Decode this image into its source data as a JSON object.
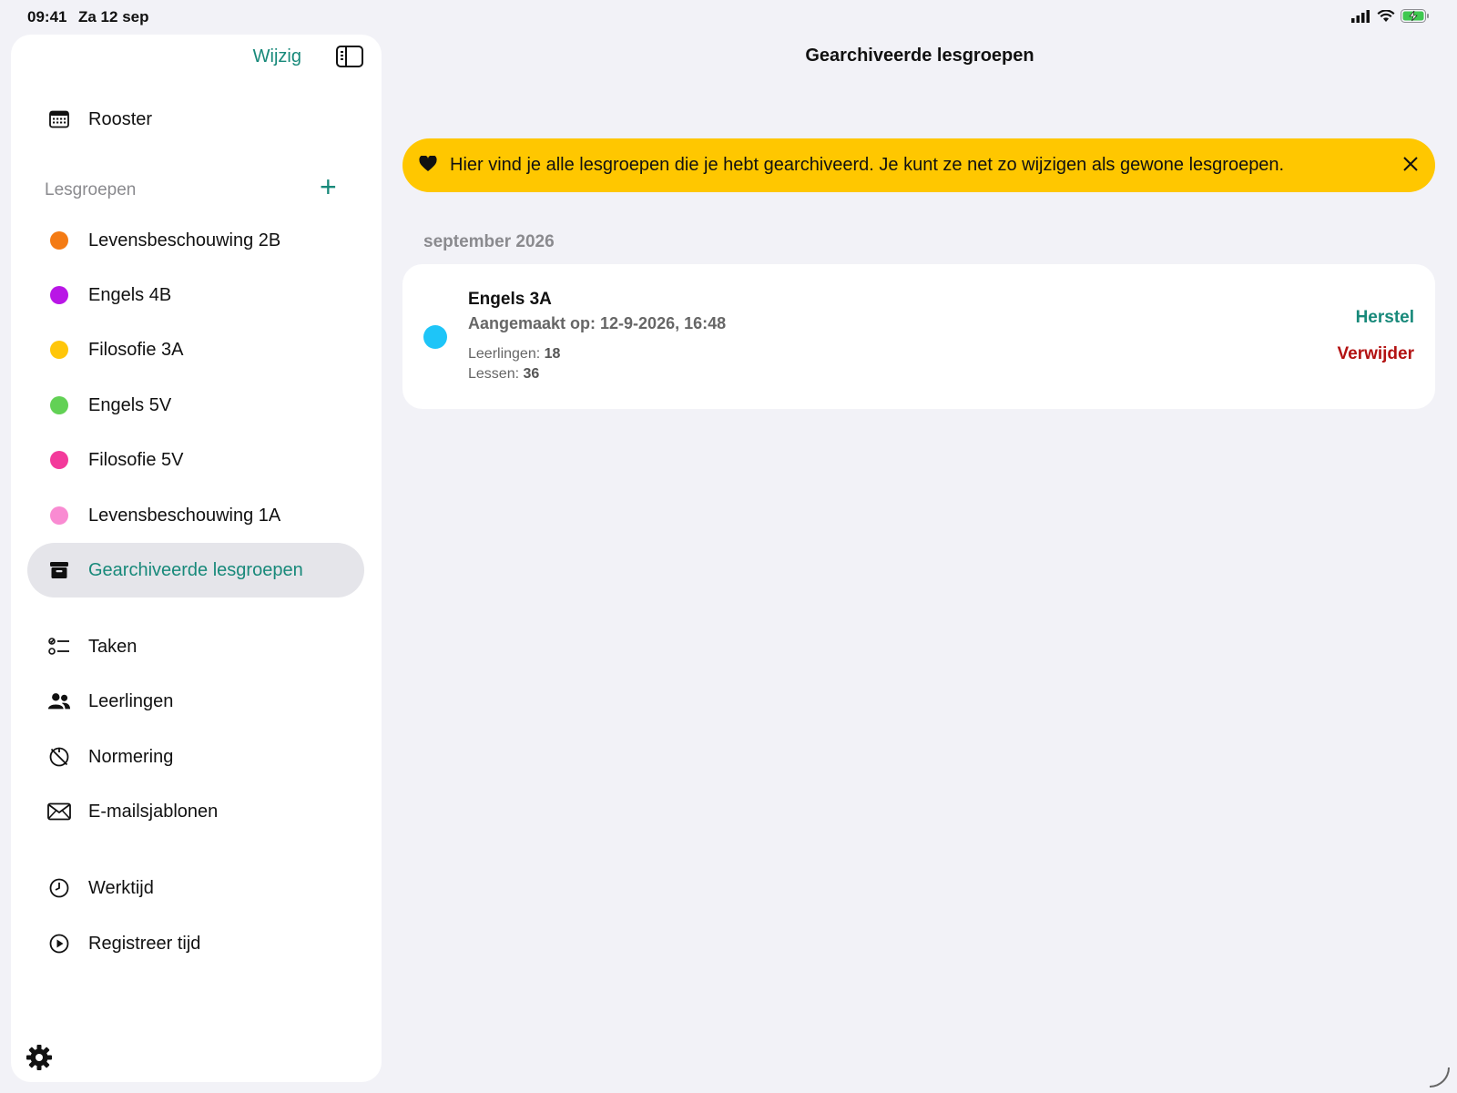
{
  "status_bar": {
    "time": "09:41",
    "date": "Za 12 sep"
  },
  "sidebar": {
    "edit_label": "Wijzig",
    "schedule_label": "Rooster",
    "groups_section_label": "Lesgroepen",
    "groups": [
      {
        "label": "Levensbeschouwing 2B",
        "color": "#f47b14"
      },
      {
        "label": "Engels 4B",
        "color": "#b916e6"
      },
      {
        "label": "Filosofie 3A",
        "color": "#ffc60a"
      },
      {
        "label": "Engels 5V",
        "color": "#62d155"
      },
      {
        "label": "Filosofie 5V",
        "color": "#f33a9b"
      },
      {
        "label": "Levensbeschouwing 1A",
        "color": "#f98bd2"
      }
    ],
    "archived_label": "Gearchiveerde lesgroepen",
    "tools": [
      {
        "label": "Taken",
        "icon": "checklist-icon"
      },
      {
        "label": "Leerlingen",
        "icon": "people-icon"
      },
      {
        "label": "Normering",
        "icon": "grading-icon"
      },
      {
        "label": "E-mailsjablonen",
        "icon": "envelope-icon"
      }
    ],
    "time_items": [
      {
        "label": "Werktijd",
        "icon": "clock-icon"
      },
      {
        "label": "Registreer tijd",
        "icon": "play-circle-icon"
      }
    ]
  },
  "main": {
    "title": "Gearchiveerde lesgroepen",
    "banner_text": "Hier vind je alle lesgroepen die je hebt gearchiveerd. Je kunt ze net zo wijzigen als gewone lesgroepen.",
    "section_label": "september 2026",
    "archived_group": {
      "name": "Engels 3A",
      "created": "Aangemaakt op: 12-9-2026, 16:48",
      "students_label": "Leerlingen:",
      "students_count": "18",
      "lessons_label": "Lessen:",
      "lessons_count": "36",
      "color": "#1ec5f8",
      "restore_label": "Herstel",
      "delete_label": "Verwijder"
    }
  },
  "colors": {
    "accent": "#18897a",
    "danger": "#b31212",
    "banner": "#ffc700"
  }
}
